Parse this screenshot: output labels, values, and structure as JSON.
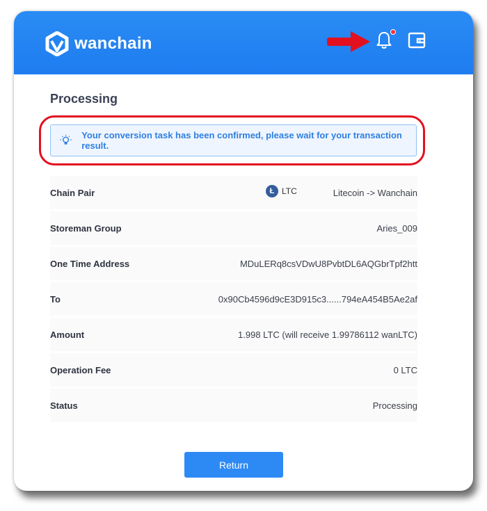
{
  "header": {
    "brand": "wanchain",
    "icons": [
      "wanchain-logo-icon",
      "red-arrow-icon",
      "bell-icon",
      "wallet-icon"
    ],
    "notification_dot_color": "#ff2d3a",
    "bg_color": "#2a8cf4"
  },
  "page": {
    "title": "Processing",
    "notice": "Your conversion task has been confirmed, please wait for your transaction result."
  },
  "details": {
    "chain_pair": {
      "label": "Chain Pair",
      "token": "LTC",
      "value": "Litecoin -> Wanchain"
    },
    "storeman": {
      "label": "Storeman Group",
      "value": "Aries_009"
    },
    "one_time_address": {
      "label": "One Time Address",
      "value": "MDuLERq8csVDwU8PvbtDL6AQGbrTpf2htt"
    },
    "to": {
      "label": "To",
      "value": "0x90Cb4596d9cE3D915c3......794eA454B5Ae2af"
    },
    "amount": {
      "label": "Amount",
      "value": "1.998 LTC (will receive 1.99786112 wanLTC)"
    },
    "fee": {
      "label": "Operation Fee",
      "value": "0 LTC"
    },
    "status": {
      "label": "Status",
      "value": "Processing"
    }
  },
  "actions": {
    "return_label": "Return"
  },
  "colors": {
    "accent": "#2d8af5",
    "highlight": "#e3101f",
    "notice_text": "#2f7fe0"
  }
}
